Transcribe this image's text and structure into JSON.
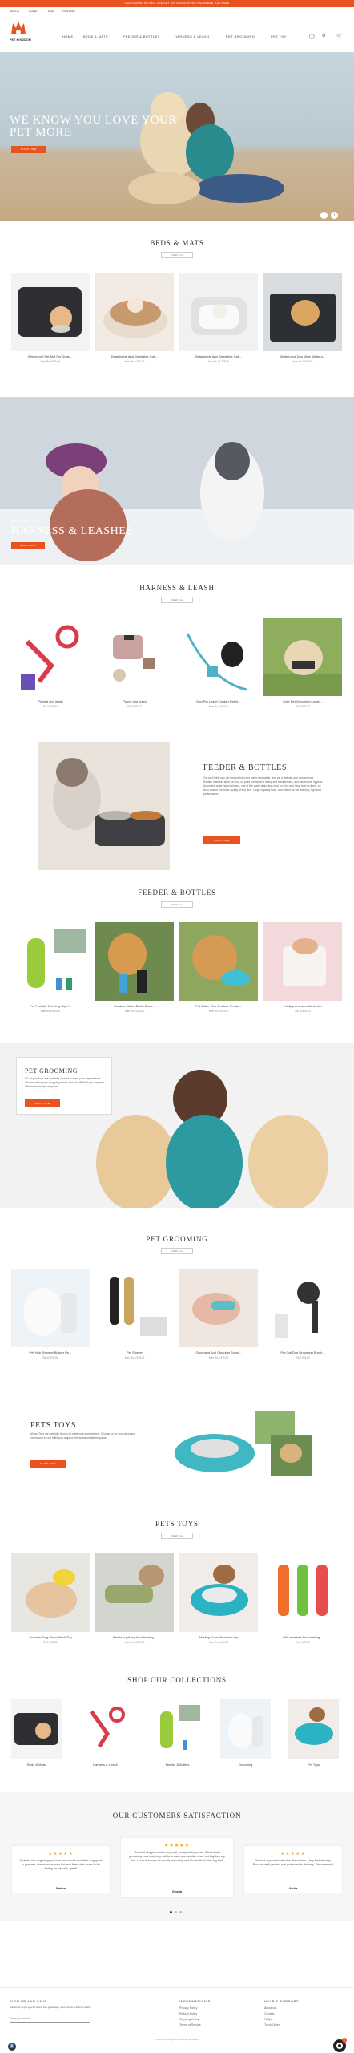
{
  "topbar": {
    "text": "USE COUPON ON SALE AND GET 10% DISCOUNT ON THE ORDER THIS WEEK"
  },
  "utility": {
    "items": [
      "About us",
      "Contact",
      "FAQs",
      "Track Order"
    ]
  },
  "header": {
    "logo_text": "PET KINGDOM",
    "nav": [
      "HOME",
      "BEDS & MATS",
      "FEEDER & BOTTLES",
      "HARNESS & LEASH",
      "PET GROOMING",
      "PET TOY"
    ],
    "cart_count": "0"
  },
  "hero": {
    "title": "WE KNOW YOU LOVE YOUR PET MORE",
    "button": "SHOP NOW"
  },
  "beds": {
    "title": "BEDS & MATS",
    "view_all": "VIEW ALL",
    "products": [
      {
        "name": "Waterproof Pet Mat For Dogs ...",
        "price": "from Rs.4,975.00"
      },
      {
        "name": "Detachable And Washable Cat ...",
        "price": "from Rs.6,050.00"
      },
      {
        "name": "Detachable And Washable Cat ...",
        "price": "from Rs.11,275.00"
      },
      {
        "name": "Waterproof Dog Mats Water a...",
        "price": "from Rs.3,575.00"
      }
    ]
  },
  "banner_harness": {
    "small": "NEW ARRIVALS",
    "title": "HARNESS & LEASHES",
    "button": "SHOP NOW"
  },
  "harness": {
    "title": "HARNESS & LEASH",
    "view_all": "VIEW ALL",
    "products": [
      {
        "name": "Printed dog leash",
        "price": "Rs.3,975.00"
      },
      {
        "name": "Puppy dog leash",
        "price": "Rs.3,475.00"
      },
      {
        "name": "Dog Pet Leash Golden Retrie...",
        "price": "from Rs.3,975.00"
      },
      {
        "name": "Cute Pet Grooming Leash...",
        "price": "Rs.2,875.00"
      }
    ]
  },
  "feature_feeder": {
    "title": "FEEDER & BOTTLES",
    "text": "Cat and Drink way pet feeders food and water separately, give pet a delicate and convenience. Smaller stainless steel, no rust, no paint, resistant to falling and tramplement, and can ensure hygiene. Automatic water replenishment, one of the water drain, less food so drink and have food so there, so as to ensure the water quality at any time. Large capacity bowl, convenient for cat and dog, high cost performance.",
    "button": "SHOP NOW"
  },
  "feeder": {
    "title": "FEEDER & BOTTLES",
    "view_all": "VIEW ALL",
    "products": [
      {
        "name": "Pet Portable Drinking Cup f...",
        "price": "from Rs.4,475.00"
      },
      {
        "name": "Outdoor Water Bottle Drink...",
        "price": "from Rs.5,975.00"
      },
      {
        "name": "Pet Water Cup Outdoor Portab...",
        "price": "from Rs.3,975.00"
      },
      {
        "name": "Intelligent automatic feeder",
        "price": "Rs.10,475.00"
      }
    ]
  },
  "banner_grooming": {
    "title": "PET GROOMING",
    "text": "All our products are carefully chosen to meet your expectations. Choose us for your shopping needs and we will fulfill your request with an immediate response.",
    "button": "SHOP NOW"
  },
  "grooming": {
    "title": "PET GROOMING",
    "view_all": "VIEW ALL",
    "products": [
      {
        "name": "Pet Hair Trimmer Blower Pe...",
        "price": "Rs.11,975.00"
      },
      {
        "name": "Pet Shaver",
        "price": "from Rs.6,975.00"
      },
      {
        "name": "Grooming And Cleaning Suppl...",
        "price": "from Rs.3,975.00"
      },
      {
        "name": "Pet Cat Dog Grooming Brush...",
        "price": "Rs.2,975.00"
      }
    ]
  },
  "feature_toys": {
    "title": "PETS TOYS",
    "text": "All our Toys are carefully chosen to meet your expectations. Choose us for your shopping needs and we will fulfill your request with an immediate response.",
    "button": "SHOP NOW"
  },
  "toys": {
    "title": "PETS TOYS",
    "view_all": "VIEW ALL",
    "products": [
      {
        "name": "Summer Dog Chew Plush Toy",
        "price": "Rs.2,975.00"
      },
      {
        "name": "Bamboo pet toy food leaking...",
        "price": "from Rs.3,975.00"
      },
      {
        "name": "Moving Food dispenser toy",
        "price": "from Rs.4,975.00"
      },
      {
        "name": "Bite resistant food leaking...",
        "price": "Rs.2,475.00"
      }
    ]
  },
  "collections": {
    "title": "SHOP OUR COLLECTIONS",
    "items": [
      "Beds & Mats",
      "Harness & Leash",
      "Feeder & Bottles",
      "Grooming",
      "Pet Toys"
    ]
  },
  "testimonials": {
    "title": "OUR CUSTOMERS SATISFACTION",
    "items": [
      {
        "stars": "★★★★★",
        "text": "Ordered the dog shopping bed for a small and dear dog quick to prepare. the room: even a hot and there she loves to be hiding on top of it. great!",
        "name": "Fatma"
      },
      {
        "stars": "★★★★★",
        "text": "The bed shipper works very well, nicely well packed. It had extra grooming care shipping visible in very new quality, does not frighten my dog. I love it as my vet scoots smoothly and I have liked this dog bed.",
        "name": "Ghalia"
      },
      {
        "stars": "★★★★★",
        "text": "Product appeared with the description. Very fast delivery. Product well packed and protected in delivery. Recommend!",
        "name": "Aisha"
      }
    ]
  },
  "footer": {
    "signup_title": "SIGN UP AND SAVE",
    "signup_text": "Subscribe to get special offers, free giveaways, and once-in-a-lifetime deals.",
    "email_placeholder": "Enter your email",
    "info_title": "INFORMATION'S",
    "info_links": [
      "Privacy Policy",
      "Refund Policy",
      "Shipping Policy",
      "Terms of Service"
    ],
    "help_title": "HELP & SUPPORT",
    "help_links": [
      "About us",
      "Contact",
      "FAQs",
      "Track Order"
    ],
    "copyright": "© 2024, Pet Kingdom Powered by Shopify"
  },
  "colors": {
    "accent": "#e8531f",
    "star": "#e8a620"
  }
}
